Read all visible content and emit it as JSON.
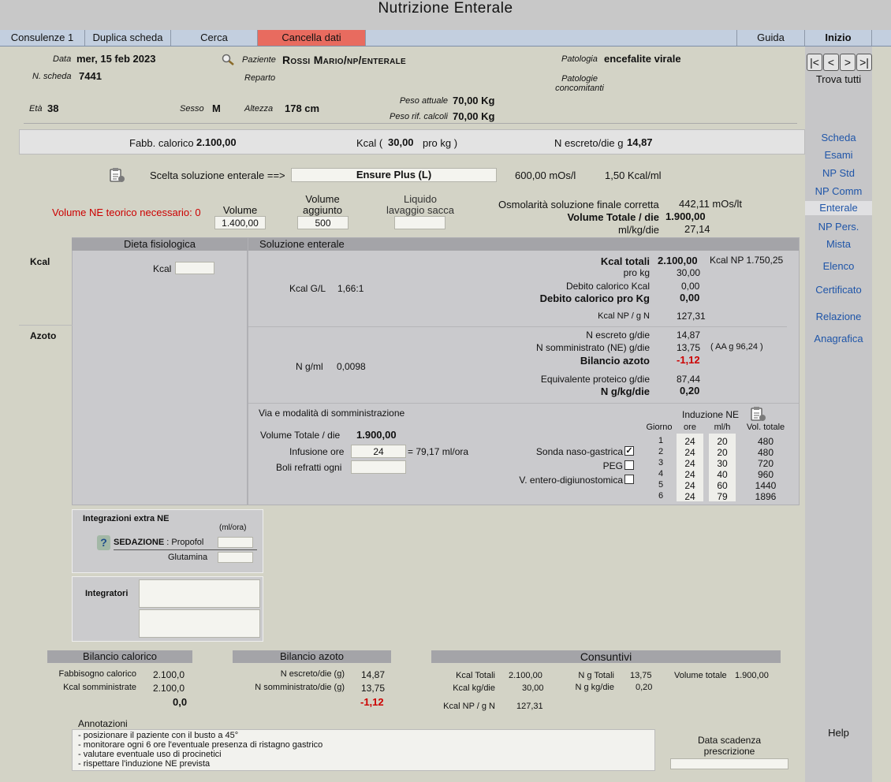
{
  "window": {
    "title": "Nutrizione  Enterale"
  },
  "nav": {
    "consulenze": "Consulenze 1",
    "duplica": "Duplica scheda",
    "cerca": "Cerca",
    "cancella": "Cancella dati",
    "guida": "Guida",
    "inizio": "Inizio"
  },
  "patient": {
    "data_label": "Data",
    "data": "mer, 15 feb 2023",
    "scheda_label": "N. scheda",
    "scheda": "7441",
    "paziente_label": "Paziente",
    "paziente": "Rossi Mario/np/enterale",
    "reparto_label": "Reparto",
    "patologia_label": "Patologia",
    "patologia": "encefalite virale",
    "concom_label1": "Patologie",
    "concom_label2": "concomitanti",
    "eta_label": "Età",
    "eta": "38",
    "sesso_label": "Sesso",
    "sesso": "M",
    "altezza_label": "Altezza",
    "altezza": "178 cm",
    "peso_att_label": "Peso attuale",
    "peso_att": "70,00 Kg",
    "peso_rif_label": "Peso rif. calcoli",
    "peso_rif": "70,00 Kg"
  },
  "summary": {
    "fabb_label": "Fabb. calorico",
    "fabb": "2.100,00",
    "kcal_label": "Kcal (",
    "kcal": "30,00",
    "prokg": "pro kg )",
    "nesc_label": "N escreto/die g",
    "nesc": "14,87"
  },
  "scelta": {
    "label": "Scelta soluzione enterale ==>",
    "value": "Ensure Plus (L)",
    "mos": "600,00 mOs/l",
    "kcalml": "1,50 Kcal/ml"
  },
  "volumes": {
    "teorico": "Volume NE teorico necessario: 0",
    "volume_label": "Volume",
    "volume": "1.400,00",
    "agg_label1": "Volume",
    "agg_label2": "aggiunto",
    "agg": "500",
    "liq_label1": "Liquido",
    "liq_label2": "lavaggio sacca",
    "liq": "",
    "osm_label": "Osmolarità soluzione finale corretta",
    "osm": "442,11 mOs/lt",
    "vtot_label": "Volume Totale / die",
    "vtot": "1.900,00",
    "mlkg_label": "ml/kg/die",
    "mlkg": "27,14"
  },
  "dieta": {
    "title": "Dieta fisiologica",
    "kcal_label": "Kcal",
    "kcal": ""
  },
  "soluzione": {
    "title": "Soluzione enterale",
    "kcal_section": "Kcal",
    "azoto_section": "Azoto",
    "kcal_gl_label": "Kcal G/L",
    "kcal_gl": "1,66:1",
    "kcal_tot_label": "Kcal totali",
    "kcal_tot": "2.100,00",
    "kcal_np": "Kcal NP 1.750,25",
    "prokg_label": "pro kg",
    "prokg": "30,00",
    "deb_label": "Debito calorico Kcal",
    "deb": "0,00",
    "debkg_label": "Debito calorico pro Kg",
    "debkg": "0,00",
    "kcalnp_label": "Kcal NP / g N",
    "kcalnp": "127,31",
    "ngml_label": "N g/ml",
    "ngml": "0,0098",
    "nesc_label": "N  escreto g/die",
    "nesc": "14,87",
    "nsom_label": "N somministrato (NE) g/die",
    "nsom": "13,75",
    "aa": "( AA g 96,24 )",
    "bil_label": "Bilancio azoto",
    "bil": "-1,12",
    "eqp_label": "Equivalente proteico g/die",
    "eqp": "87,44",
    "ngkg_label": "N g/kg/die",
    "ngkg": "0,20"
  },
  "via": {
    "title": "Via e modalità di somministrazione",
    "vtot_label": "Volume Totale / die",
    "vtot": "1.900,00",
    "inf_label": "Infusione ore",
    "inf": "24",
    "inf_rate": "= 79,17 ml/ora",
    "boli_label": "Boli refratti ogni",
    "boli": "",
    "sonda": "Sonda naso-gastrica",
    "peg": "PEG",
    "ved": "V. entero-digiunostomica",
    "checkmark": "✓"
  },
  "induzione": {
    "title": "Induzione NE",
    "headers": [
      "Giorno",
      "ore",
      "ml/h",
      "Vol. totale"
    ],
    "rows": [
      [
        "1",
        "24",
        "20",
        "480"
      ],
      [
        "2",
        "24",
        "20",
        "480"
      ],
      [
        "3",
        "24",
        "30",
        "720"
      ],
      [
        "4",
        "24",
        "40",
        "960"
      ],
      [
        "5",
        "24",
        "60",
        "1440"
      ],
      [
        "6",
        "24",
        "79",
        "1896"
      ]
    ]
  },
  "integrazioni": {
    "title": "Integrazioni extra NE",
    "unit": "(ml/ora)",
    "help": "?",
    "sed_label": "SEDAZIONE",
    "sed_drug": ": Propofol",
    "sed": "",
    "glut_label": "Glutamina",
    "glut": ""
  },
  "integratori": {
    "title": "Integratori"
  },
  "bil_cal": {
    "title": "Bilancio calorico",
    "fabb_label": "Fabbisogno calorico",
    "fabb": "2.100,0",
    "som_label": "Kcal somministrate",
    "som": "2.100,0",
    "tot": "0,0"
  },
  "bil_az": {
    "title": "Bilancio azoto",
    "nesc_label": "N escreto/die (g)",
    "nesc": "14,87",
    "nsom_label": "N somministrato/die (g)",
    "nsom": "13,75",
    "tot": "-1,12"
  },
  "consuntivi": {
    "title": "Consuntivi",
    "kt_label": "Kcal Totali",
    "kt": "2.100,00",
    "kkg_label": "Kcal kg/die",
    "kkg": "30,00",
    "knp_label": "Kcal NP / g N",
    "knp": "127,31",
    "ngt_label": "N g Totali",
    "ngt": "13,75",
    "ngkg_label": "N g kg/die",
    "ngkg": "0,20",
    "vt_label": "Volume totale",
    "vt": "1.900,00"
  },
  "annotazioni": {
    "title": "Annotazioni",
    "lines": [
      "- posizionare il paziente con il busto a 45°",
      "- monitorare ogni 6 ore l'eventuale presenza di ristagno gastrico",
      "- valutare eventuale uso di procinetici",
      "- rispettare l'induzione NE prevista"
    ]
  },
  "scadenza": {
    "label1": "Data scadenza",
    "label2": "prescrizione",
    "value": ""
  },
  "sidebar": {
    "trova": "Trova tutti",
    "nav_buttons": [
      "|<",
      "<",
      ">",
      ">|"
    ],
    "items": [
      "Scheda",
      "Esami",
      "NP Std",
      "NP Comm",
      "Enterale",
      "NP Pers.",
      "Mista",
      "Elenco",
      "Certificato",
      "Relazione",
      "Anagrafica"
    ],
    "help": "Help"
  },
  "colors": {
    "accent_red": "#e86b5f",
    "link_blue": "#1f55a8",
    "alert_red": "#cc0000"
  }
}
